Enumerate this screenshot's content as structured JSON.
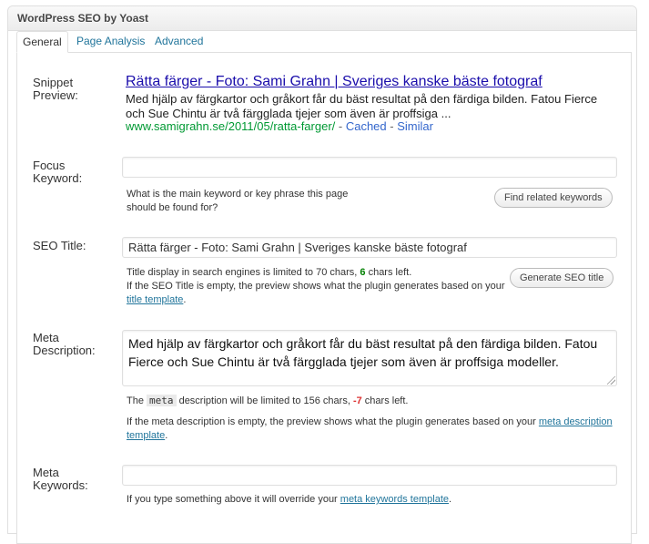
{
  "header": {
    "title": "WordPress SEO by Yoast"
  },
  "tabs": [
    {
      "label": "General",
      "active": true
    },
    {
      "label": "Page Analysis",
      "active": false
    },
    {
      "label": "Advanced",
      "active": false
    }
  ],
  "snippet": {
    "label": "Snippet Preview:",
    "title": "Rätta färger - Foto: Sami Grahn | Sveriges kanske bäste fotograf",
    "description": "Med hjälp av färgkartor och gråkort får du bäst resultat på den färdiga bilden. Fatou Fierce och Sue Chintu är två färgglada tjejer som även är proffsiga ...",
    "url": "www.samigrahn.se/2011/05/ratta-farger/",
    "separator": " - ",
    "cached": "Cached",
    "similar": "Similar"
  },
  "focus_keyword": {
    "label": "Focus Keyword:",
    "value": "",
    "placeholder": "",
    "hint": "What is the main keyword or key phrase this page should be found for?",
    "button": "Find related keywords"
  },
  "seo_title": {
    "label": "SEO Title:",
    "value": "Rätta färger - Foto: Sami Grahn | Sveriges kanske bäste fotograf",
    "hint_pre": "Title display in search engines is limited to 70 chars, ",
    "chars_left": "6",
    "hint_post": " chars left.",
    "hint2_pre": "If the SEO Title is empty, the preview shows what the plugin generates based on your ",
    "hint2_link": "title template",
    "hint2_post": ".",
    "button": "Generate SEO title"
  },
  "meta_description": {
    "label": "Meta Description:",
    "value": "Med hjälp av färgkartor och gråkort får du bäst resultat på den färdiga bilden. Fatou Fierce och Sue Chintu är två färgglada tjejer som även är proffsiga modeller.",
    "hint_the": "The ",
    "hint_code": "meta",
    "hint_mid": " description will be limited to 156 chars, ",
    "chars_left": "-7",
    "hint_end": " chars left.",
    "hint2_pre": "If the meta description is empty, the preview shows what the plugin generates based on your ",
    "hint2_link": "meta description template",
    "hint2_post": "."
  },
  "meta_keywords": {
    "label": "Meta Keywords:",
    "value": "",
    "hint_pre": "If you type something above it will override your ",
    "hint_link": "meta keywords template",
    "hint_post": "."
  },
  "colors": {
    "link": "#21759b",
    "snippet_title": "#1a0dab",
    "snippet_url": "#009933",
    "good": "#008000",
    "bad": "#dc3232"
  }
}
